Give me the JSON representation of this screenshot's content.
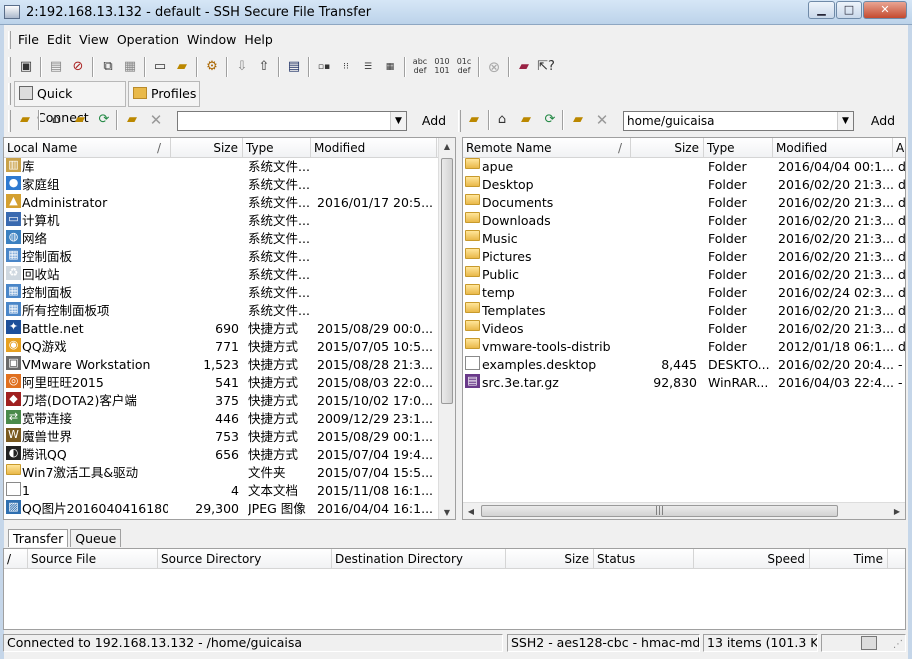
{
  "window": {
    "title": "2:192.168.13.132 - default - SSH Secure File Transfer"
  },
  "menu": [
    "File",
    "Edit",
    "View",
    "Operation",
    "Window",
    "Help"
  ],
  "quick": {
    "connect_label": "Quick Connect",
    "profiles_label": "Profiles"
  },
  "local": {
    "path_value": "",
    "add_label": "Add",
    "columns": [
      "Local Name",
      "Size",
      "Type",
      "Modified"
    ],
    "rows": [
      {
        "name": "库",
        "size": "",
        "type": "系统文件...",
        "modified": "",
        "icon": "library-icon"
      },
      {
        "name": "家庭组",
        "size": "",
        "type": "系统文件...",
        "modified": "",
        "icon": "homegroup-icon"
      },
      {
        "name": "Administrator",
        "size": "",
        "type": "系统文件...",
        "modified": "2016/01/17 20:5...",
        "icon": "user-folder-icon"
      },
      {
        "name": "计算机",
        "size": "",
        "type": "系统文件...",
        "modified": "",
        "icon": "computer-icon"
      },
      {
        "name": "网络",
        "size": "",
        "type": "系统文件...",
        "modified": "",
        "icon": "network-icon"
      },
      {
        "name": "控制面板",
        "size": "",
        "type": "系统文件...",
        "modified": "",
        "icon": "control-panel-icon"
      },
      {
        "name": "回收站",
        "size": "",
        "type": "系统文件...",
        "modified": "",
        "icon": "recycle-bin-icon"
      },
      {
        "name": "控制面板",
        "size": "",
        "type": "系统文件...",
        "modified": "",
        "icon": "control-panel-icon"
      },
      {
        "name": "所有控制面板项",
        "size": "",
        "type": "系统文件...",
        "modified": "",
        "icon": "control-panel-icon"
      },
      {
        "name": "Battle.net",
        "size": "690",
        "type": "快捷方式",
        "modified": "2015/08/29 00:0...",
        "icon": "battlenet-icon"
      },
      {
        "name": "QQ游戏",
        "size": "771",
        "type": "快捷方式",
        "modified": "2015/07/05 10:5...",
        "icon": "qq-game-icon"
      },
      {
        "name": "VMware Workstation",
        "size": "1,523",
        "type": "快捷方式",
        "modified": "2015/08/28 21:3...",
        "icon": "vmware-icon"
      },
      {
        "name": "阿里旺旺2015",
        "size": "541",
        "type": "快捷方式",
        "modified": "2015/08/03 22:0...",
        "icon": "aliwangwang-icon"
      },
      {
        "name": "刀塔(DOTA2)客户端",
        "size": "375",
        "type": "快捷方式",
        "modified": "2015/10/02 17:0...",
        "icon": "dota2-icon"
      },
      {
        "name": "宽带连接",
        "size": "446",
        "type": "快捷方式",
        "modified": "2009/12/29 23:1...",
        "icon": "broadband-icon"
      },
      {
        "name": "魔兽世界",
        "size": "753",
        "type": "快捷方式",
        "modified": "2015/08/29 00:1...",
        "icon": "wow-icon"
      },
      {
        "name": "腾讯QQ",
        "size": "656",
        "type": "快捷方式",
        "modified": "2015/07/04 19:4...",
        "icon": "qq-icon"
      },
      {
        "name": "Win7激活工具&驱动",
        "size": "",
        "type": "文件夹",
        "modified": "2015/07/04 15:5...",
        "icon": "folder-icon"
      },
      {
        "name": "1",
        "size": "4",
        "type": "文本文档",
        "modified": "2015/11/08 16:1...",
        "icon": "text-file-icon"
      },
      {
        "name": "QQ图片20160404161809",
        "size": "29,300",
        "type": "JPEG 图像",
        "modified": "2016/04/04 16:1...",
        "icon": "image-file-icon"
      }
    ]
  },
  "remote": {
    "path_value": "home/guicaisa",
    "add_label": "Add",
    "columns": [
      "Remote Name",
      "Size",
      "Type",
      "Modified",
      "A"
    ],
    "rows": [
      {
        "name": "apue",
        "size": "",
        "type": "Folder",
        "modified": "2016/04/04 00:1...",
        "attr": "d",
        "icon": "folder-icon"
      },
      {
        "name": "Desktop",
        "size": "",
        "type": "Folder",
        "modified": "2016/02/20 21:3...",
        "attr": "d",
        "icon": "folder-icon"
      },
      {
        "name": "Documents",
        "size": "",
        "type": "Folder",
        "modified": "2016/02/20 21:3...",
        "attr": "d",
        "icon": "folder-icon"
      },
      {
        "name": "Downloads",
        "size": "",
        "type": "Folder",
        "modified": "2016/02/20 21:3...",
        "attr": "d",
        "icon": "folder-icon"
      },
      {
        "name": "Music",
        "size": "",
        "type": "Folder",
        "modified": "2016/02/20 21:3...",
        "attr": "d",
        "icon": "folder-icon"
      },
      {
        "name": "Pictures",
        "size": "",
        "type": "Folder",
        "modified": "2016/02/20 21:3...",
        "attr": "d",
        "icon": "folder-icon"
      },
      {
        "name": "Public",
        "size": "",
        "type": "Folder",
        "modified": "2016/02/20 21:3...",
        "attr": "d",
        "icon": "folder-icon"
      },
      {
        "name": "temp",
        "size": "",
        "type": "Folder",
        "modified": "2016/02/24 02:3...",
        "attr": "d",
        "icon": "folder-icon"
      },
      {
        "name": "Templates",
        "size": "",
        "type": "Folder",
        "modified": "2016/02/20 21:3...",
        "attr": "d",
        "icon": "folder-icon"
      },
      {
        "name": "Videos",
        "size": "",
        "type": "Folder",
        "modified": "2016/02/20 21:3...",
        "attr": "d",
        "icon": "folder-icon"
      },
      {
        "name": "vmware-tools-distrib",
        "size": "",
        "type": "Folder",
        "modified": "2012/01/18 06:1...",
        "attr": "d",
        "icon": "folder-icon"
      },
      {
        "name": "examples.desktop",
        "size": "8,445",
        "type": "DESKTO...",
        "modified": "2016/02/20 20:4...",
        "attr": "-",
        "icon": "text-file-icon"
      },
      {
        "name": "src.3e.tar.gz",
        "size": "92,830",
        "type": "WinRAR...",
        "modified": "2016/04/03 22:4...",
        "attr": "-",
        "icon": "archive-icon"
      }
    ]
  },
  "transfer": {
    "tabs": [
      "Transfer",
      "Queue"
    ],
    "columns": [
      "/",
      "Source File",
      "Source Directory",
      "Destination Directory",
      "Size",
      "Status",
      "Speed",
      "Time"
    ]
  },
  "status": {
    "connection": "Connected to 192.168.13.132 - /home/guicaisa",
    "cipher": "SSH2 - aes128-cbc - hmac-md5",
    "items": "13 items (101.3 KB)"
  },
  "colors": {
    "title_bar": "#bcd3ea",
    "folder": "#e9b94a",
    "close_button": "#c44a2f"
  }
}
